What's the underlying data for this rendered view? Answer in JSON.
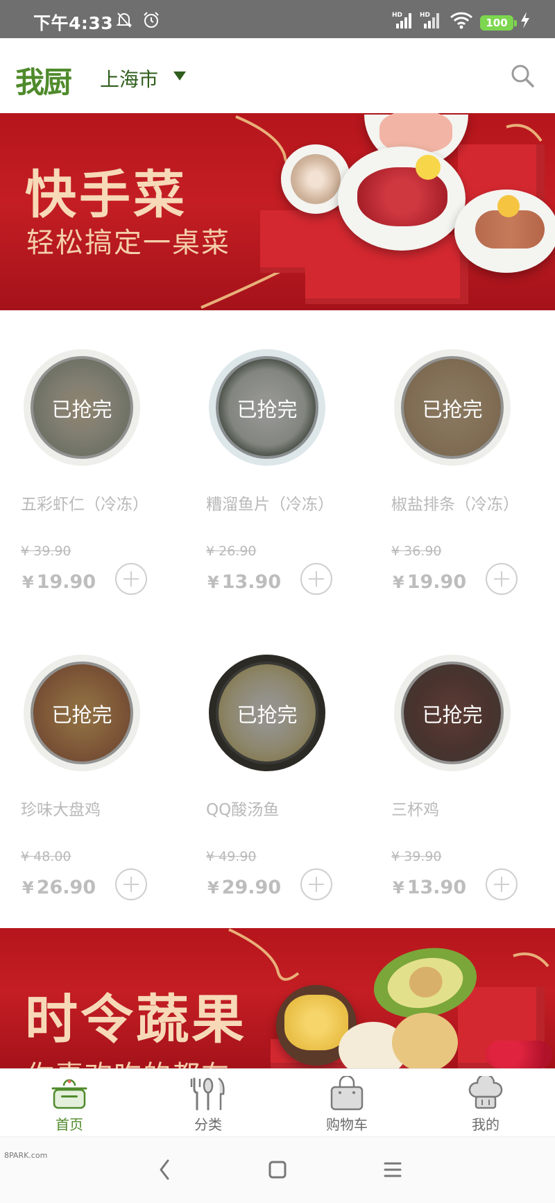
{
  "status_bar": {
    "time": "下午4:33",
    "battery": "100",
    "icons": [
      "mute-bell-icon",
      "alarm-icon",
      "hd-signal-icon",
      "hd-signal-icon",
      "wifi-icon",
      "battery-icon",
      "charging-icon"
    ]
  },
  "header": {
    "logo": "我厨",
    "city": "上海市",
    "icons": [
      "dropdown-caret-icon",
      "search-icon"
    ]
  },
  "banner_top": {
    "title": "快手菜",
    "subtitle": "轻松搞定一桌菜"
  },
  "products": [
    {
      "name": "五彩虾仁（冷冻）",
      "old_price": "¥ 39.90",
      "currency": "¥",
      "price": "19.90",
      "status": "已抢完"
    },
    {
      "name": "糟溜鱼片（冷冻）",
      "old_price": "¥ 26.90",
      "currency": "¥",
      "price": "13.90",
      "status": "已抢完"
    },
    {
      "name": "椒盐排条（冷冻）",
      "old_price": "¥ 36.90",
      "currency": "¥",
      "price": "19.90",
      "status": "已抢完"
    },
    {
      "name": "珍味大盘鸡",
      "old_price": "¥ 48.00",
      "currency": "¥",
      "price": "26.90",
      "status": "已抢完"
    },
    {
      "name": "QQ酸汤鱼",
      "old_price": "¥ 49.90",
      "currency": "¥",
      "price": "29.90",
      "status": "已抢完"
    },
    {
      "name": "三杯鸡",
      "old_price": "¥ 39.90",
      "currency": "¥",
      "price": "13.90",
      "status": "已抢完"
    }
  ],
  "banner_bottom": {
    "title": "时令蔬果",
    "subtitle": "你喜欢吃的都在"
  },
  "tab_bar": {
    "tabs": [
      {
        "label": "首页",
        "icon": "cooking-pot-icon",
        "active": true
      },
      {
        "label": "分类",
        "icon": "utensils-icon",
        "active": false
      },
      {
        "label": "购物车",
        "icon": "shopping-bag-icon",
        "active": false
      },
      {
        "label": "我的",
        "icon": "chef-hat-icon",
        "active": false
      }
    ]
  },
  "nav_bar": {
    "icons": [
      "back-icon",
      "home-icon",
      "menu-icon"
    ]
  },
  "watermark": "8PARK.com",
  "colors": {
    "brand_green": "#4f8a2b",
    "banner_red": "#c41e24",
    "muted_gray": "#b9b9b9"
  }
}
